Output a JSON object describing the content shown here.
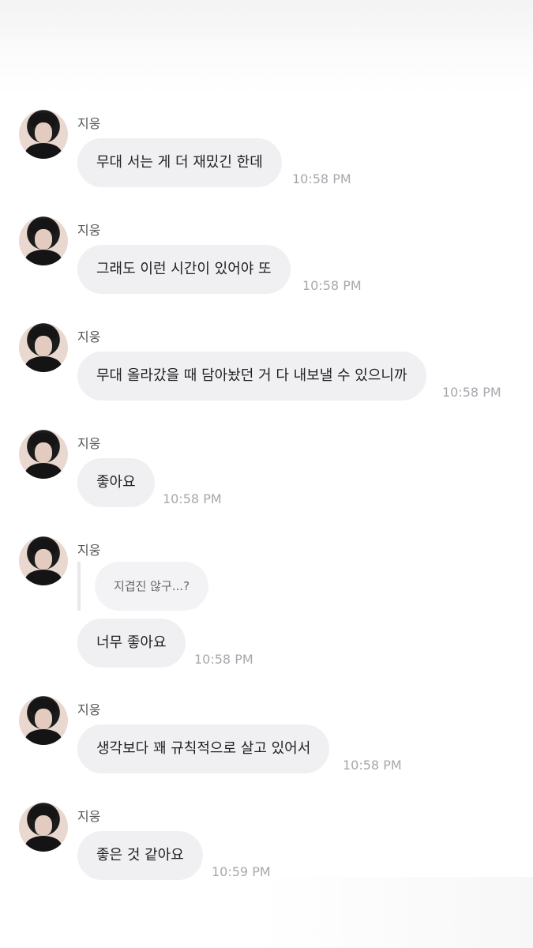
{
  "messages": [
    {
      "sender": "지웅",
      "text": "무대 서는 게 더 재밌긴 한데",
      "time": "10:58 PM"
    },
    {
      "sender": "지웅",
      "text": "그래도 이런 시간이 있어야 또",
      "time": "10:58 PM"
    },
    {
      "sender": "지웅",
      "text": "무대 올라갔을 때 담아놨던 거 다 내보낼 수 있으니까",
      "time": "10:58 PM"
    },
    {
      "sender": "지웅",
      "text": "좋아요",
      "time": "10:58 PM"
    },
    {
      "sender": "지웅",
      "reply_to": "지겹진 않구...?",
      "text": "너무 좋아요",
      "time": "10:58 PM"
    },
    {
      "sender": "지웅",
      "text": "생각보다 꽤 규칙적으로 살고 있어서",
      "time": "10:58 PM"
    },
    {
      "sender": "지웅",
      "text": "좋은 것 같아요",
      "time": "10:59 PM"
    }
  ]
}
